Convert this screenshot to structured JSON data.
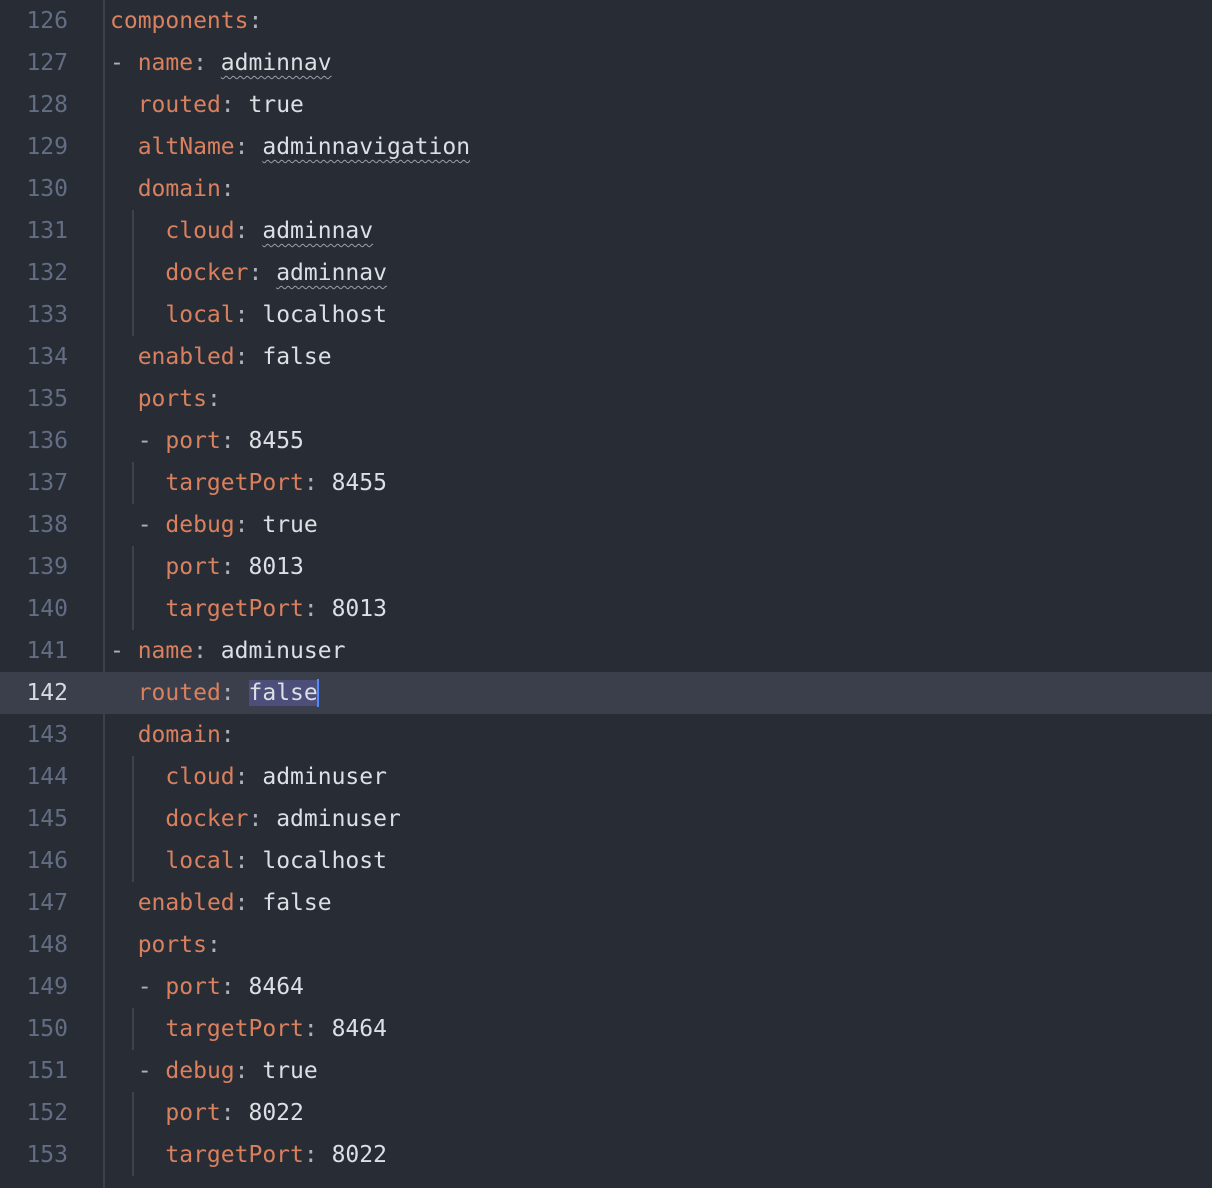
{
  "editor": {
    "current_line": "142",
    "lines": [
      {
        "n": "126",
        "indent": "",
        "dash": "",
        "key": "components",
        "sep": ":",
        "value": "",
        "squiggle": false
      },
      {
        "n": "127",
        "indent": "",
        "dash": "- ",
        "key": "name",
        "sep": ": ",
        "value": "adminnav",
        "squiggle": true
      },
      {
        "n": "128",
        "indent": "  ",
        "dash": "",
        "key": "routed",
        "sep": ": ",
        "value": "true",
        "squiggle": false
      },
      {
        "n": "129",
        "indent": "  ",
        "dash": "",
        "key": "altName",
        "sep": ": ",
        "value": "adminnavigation",
        "squiggle": true
      },
      {
        "n": "130",
        "indent": "  ",
        "dash": "",
        "key": "domain",
        "sep": ":",
        "value": "",
        "squiggle": false
      },
      {
        "n": "131",
        "indent": "    ",
        "dash": "",
        "key": "cloud",
        "sep": ": ",
        "value": "adminnav",
        "squiggle": true
      },
      {
        "n": "132",
        "indent": "    ",
        "dash": "",
        "key": "docker",
        "sep": ": ",
        "value": "adminnav",
        "squiggle": true
      },
      {
        "n": "133",
        "indent": "    ",
        "dash": "",
        "key": "local",
        "sep": ": ",
        "value": "localhost",
        "squiggle": false
      },
      {
        "n": "134",
        "indent": "  ",
        "dash": "",
        "key": "enabled",
        "sep": ": ",
        "value": "false",
        "squiggle": false
      },
      {
        "n": "135",
        "indent": "  ",
        "dash": "",
        "key": "ports",
        "sep": ":",
        "value": "",
        "squiggle": false
      },
      {
        "n": "136",
        "indent": "  ",
        "dash": "- ",
        "key": "port",
        "sep": ": ",
        "value": "8455",
        "squiggle": false
      },
      {
        "n": "137",
        "indent": "    ",
        "dash": "",
        "key": "targetPort",
        "sep": ": ",
        "value": "8455",
        "squiggle": false
      },
      {
        "n": "138",
        "indent": "  ",
        "dash": "- ",
        "key": "debug",
        "sep": ": ",
        "value": "true",
        "squiggle": false
      },
      {
        "n": "139",
        "indent": "    ",
        "dash": "",
        "key": "port",
        "sep": ": ",
        "value": "8013",
        "squiggle": false
      },
      {
        "n": "140",
        "indent": "    ",
        "dash": "",
        "key": "targetPort",
        "sep": ": ",
        "value": "8013",
        "squiggle": false
      },
      {
        "n": "141",
        "indent": "",
        "dash": "- ",
        "key": "name",
        "sep": ": ",
        "value": "adminuser",
        "squiggle": false
      },
      {
        "n": "142",
        "indent": "  ",
        "dash": "",
        "key": "routed",
        "sep": ": ",
        "value": "false",
        "squiggle": false
      },
      {
        "n": "143",
        "indent": "  ",
        "dash": "",
        "key": "domain",
        "sep": ":",
        "value": "",
        "squiggle": false
      },
      {
        "n": "144",
        "indent": "    ",
        "dash": "",
        "key": "cloud",
        "sep": ": ",
        "value": "adminuser",
        "squiggle": false
      },
      {
        "n": "145",
        "indent": "    ",
        "dash": "",
        "key": "docker",
        "sep": ": ",
        "value": "adminuser",
        "squiggle": false
      },
      {
        "n": "146",
        "indent": "    ",
        "dash": "",
        "key": "local",
        "sep": ": ",
        "value": "localhost",
        "squiggle": false
      },
      {
        "n": "147",
        "indent": "  ",
        "dash": "",
        "key": "enabled",
        "sep": ": ",
        "value": "false",
        "squiggle": false
      },
      {
        "n": "148",
        "indent": "  ",
        "dash": "",
        "key": "ports",
        "sep": ":",
        "value": "",
        "squiggle": false
      },
      {
        "n": "149",
        "indent": "  ",
        "dash": "- ",
        "key": "port",
        "sep": ": ",
        "value": "8464",
        "squiggle": false
      },
      {
        "n": "150",
        "indent": "    ",
        "dash": "",
        "key": "targetPort",
        "sep": ": ",
        "value": "8464",
        "squiggle": false
      },
      {
        "n": "151",
        "indent": "  ",
        "dash": "- ",
        "key": "debug",
        "sep": ": ",
        "value": "true",
        "squiggle": false
      },
      {
        "n": "152",
        "indent": "    ",
        "dash": "",
        "key": "port",
        "sep": ": ",
        "value": "8022",
        "squiggle": false
      },
      {
        "n": "153",
        "indent": "    ",
        "dash": "",
        "key": "targetPort",
        "sep": ": ",
        "value": "8022",
        "squiggle": false
      }
    ],
    "colors": {
      "background": "#282c34",
      "key": "#d9805f",
      "value": "#dcdfe4",
      "line_number": "#636d83",
      "current_line_bg": "#3a3f4b",
      "selection": "#4d4f7a",
      "cursor": "#528bff"
    }
  }
}
